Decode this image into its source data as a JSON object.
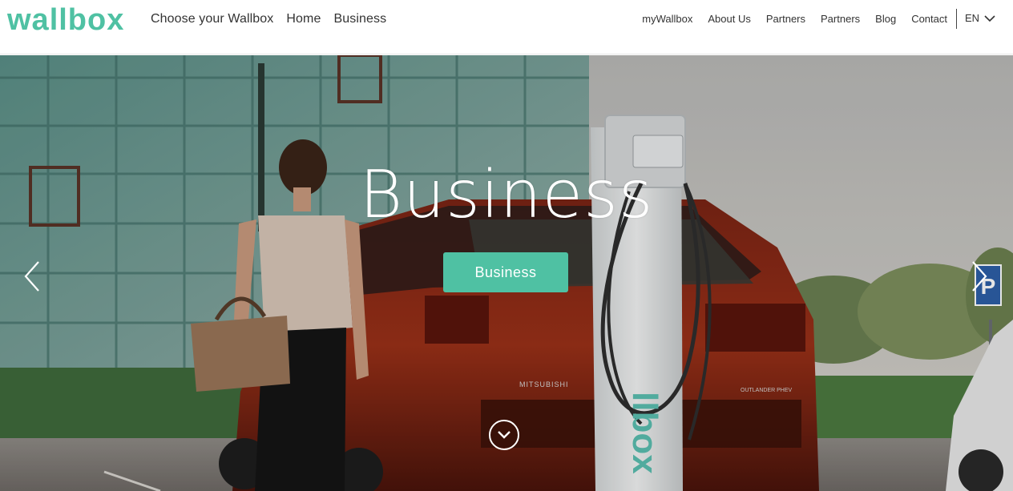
{
  "brand": {
    "logo_text": "wallbox",
    "accent_color": "#4fc1a3"
  },
  "nav_primary": [
    {
      "label": "Choose your Wallbox"
    },
    {
      "label": "Home"
    },
    {
      "label": "Business"
    }
  ],
  "nav_secondary": [
    {
      "label": "myWallbox"
    },
    {
      "label": "About Us"
    },
    {
      "label": "Partners"
    },
    {
      "label": "Partners"
    },
    {
      "label": "Blog"
    },
    {
      "label": "Contact"
    }
  ],
  "language": {
    "current": "EN",
    "icon": "chevron-down-icon"
  },
  "hero": {
    "title": "Business",
    "cta_label": "Business",
    "prev_icon": "chevron-left-icon",
    "next_icon": "chevron-right-icon",
    "scroll_icon": "chevron-down-circle-icon",
    "charger_brand_text": "llbox",
    "car_make_badge": "MITSUBISHI",
    "car_model_badge": "OUTLANDER PHEV"
  }
}
